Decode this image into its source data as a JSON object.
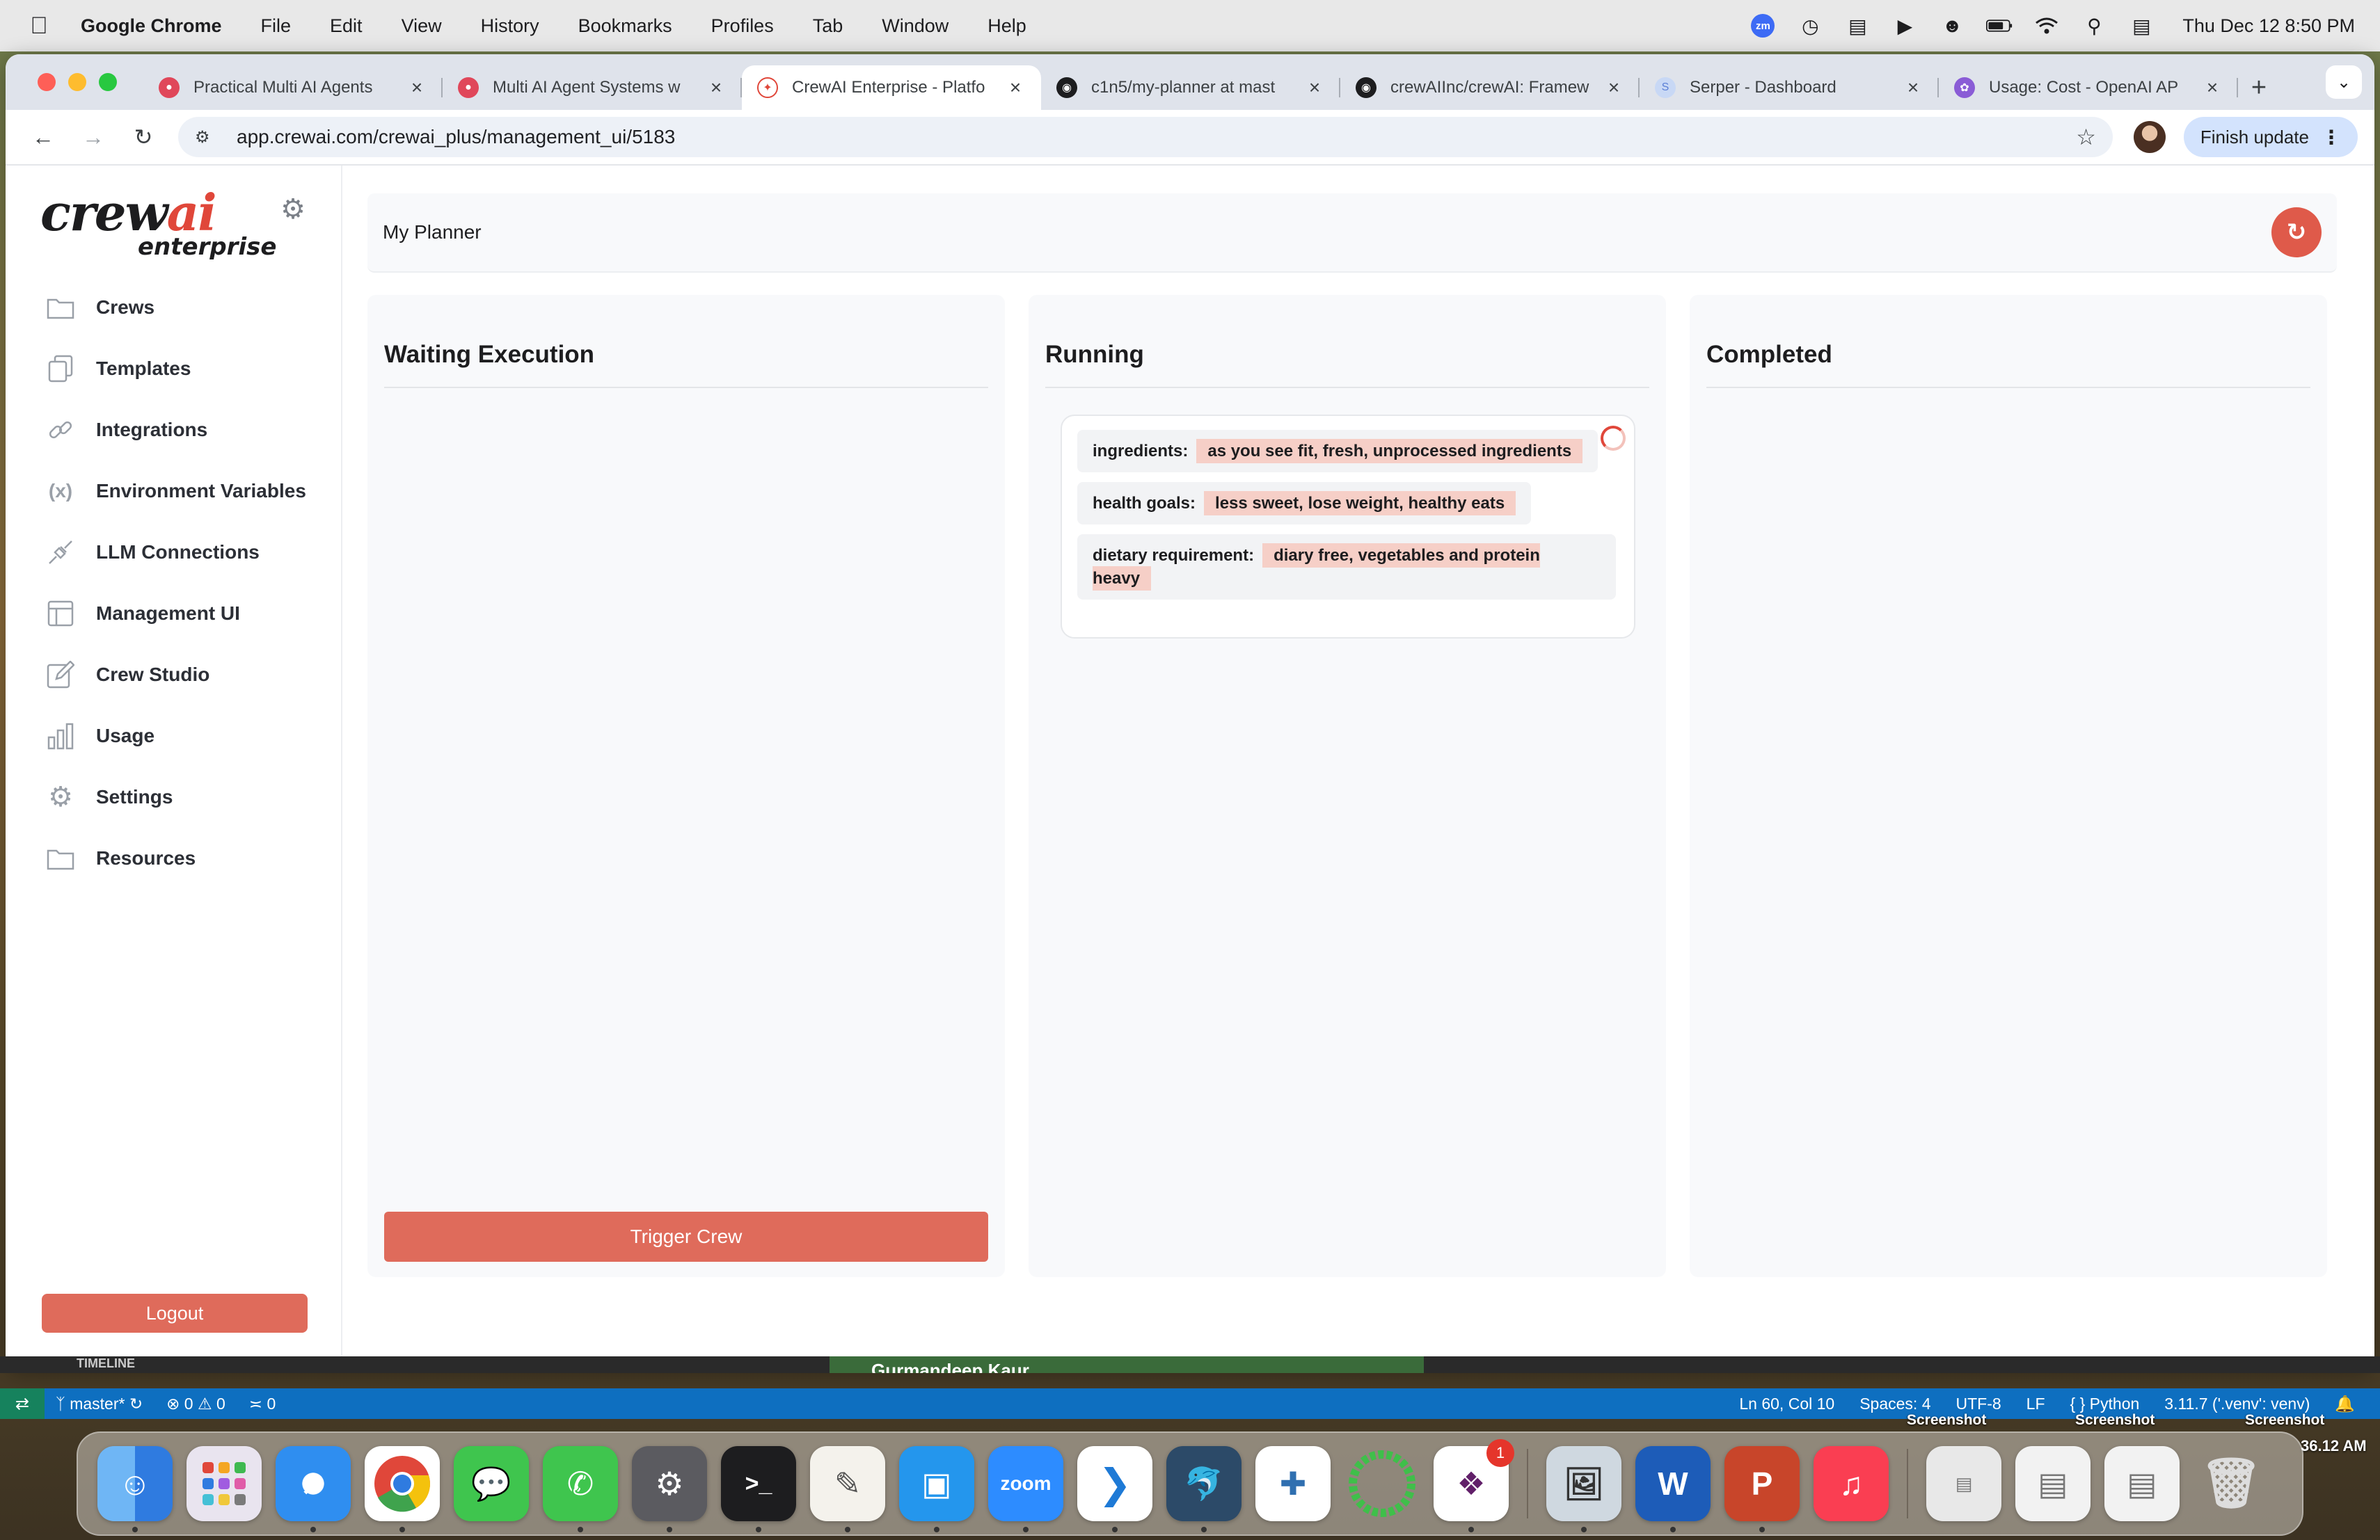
{
  "menubar": {
    "app_name": "Google Chrome",
    "items": [
      "File",
      "Edit",
      "View",
      "History",
      "Bookmarks",
      "Profiles",
      "Tab",
      "Window",
      "Help"
    ],
    "clock": "Thu Dec 12  8:50 PM",
    "status_icons": [
      "zoom-icon",
      "time-machine-icon",
      "bed-icon",
      "play-icon",
      "user-icon",
      "battery-icon",
      "wifi-icon",
      "search-icon",
      "control-center-icon"
    ]
  },
  "browser": {
    "tabs": [
      {
        "title": "Practical Multi AI Agents",
        "favicon": "crewai-icon"
      },
      {
        "title": "Multi AI Agent Systems w",
        "favicon": "crewai-icon"
      },
      {
        "title": "CrewAI Enterprise - Platfo",
        "favicon": "crewai-icon",
        "active": true
      },
      {
        "title": "c1n5/my-planner at mast",
        "favicon": "github-icon"
      },
      {
        "title": "crewAIInc/crewAI: Framew",
        "favicon": "github-icon"
      },
      {
        "title": "Serper - Dashboard",
        "favicon": "serper-icon"
      },
      {
        "title": "Usage: Cost - OpenAI AP",
        "favicon": "openai-icon"
      }
    ],
    "url": "app.crewai.com/crewai_plus/management_ui/5183",
    "finish_update": "Finish update"
  },
  "sidebar": {
    "logo_text": "crewai",
    "logo_sub": "enterprise",
    "items": [
      {
        "label": "Crews",
        "icon": "folder-icon"
      },
      {
        "label": "Templates",
        "icon": "copy-icon"
      },
      {
        "label": "Integrations",
        "icon": "link-icon"
      },
      {
        "label": "Environment Variables",
        "icon": "variable-icon"
      },
      {
        "label": "LLM Connections",
        "icon": "plug-icon"
      },
      {
        "label": "Management UI",
        "icon": "layout-icon"
      },
      {
        "label": "Crew Studio",
        "icon": "edit-icon"
      },
      {
        "label": "Usage",
        "icon": "bar-chart-icon"
      },
      {
        "label": "Settings",
        "icon": "gear-icon"
      },
      {
        "label": "Resources",
        "icon": "folder-icon"
      }
    ],
    "logout": "Logout"
  },
  "main": {
    "title": "My Planner",
    "columns": {
      "waiting": "Waiting Execution",
      "running": "Running",
      "completed": "Completed"
    },
    "trigger": "Trigger Crew",
    "running_card": {
      "fields": [
        {
          "key": "ingredients:",
          "value": "as you see fit, fresh, unprocessed ingredients"
        },
        {
          "key": "health goals:",
          "value": "less sweet, lose weight, healthy eats"
        },
        {
          "key": "dietary requirement:",
          "value": "diary free, vegetables and protein heavy"
        }
      ]
    }
  },
  "vscode_status": {
    "branch": "master*",
    "errors": "0",
    "warnings": "0",
    "ports": "0",
    "position": "Ln 60, Col 10",
    "spaces": "Spaces: 4",
    "encoding": "UTF-8",
    "eol": "LF",
    "language": "Python",
    "interpreter": "3.11.7 ('.venv': venv)",
    "timeline": "TIMELINE",
    "video_name": "Gurmandeep Kaur"
  },
  "desktop": {
    "screenshot_label": "Screenshot",
    "clock_fragment": "36.12 AM",
    "dock_badge": "1",
    "zoom_label": "zoom"
  }
}
